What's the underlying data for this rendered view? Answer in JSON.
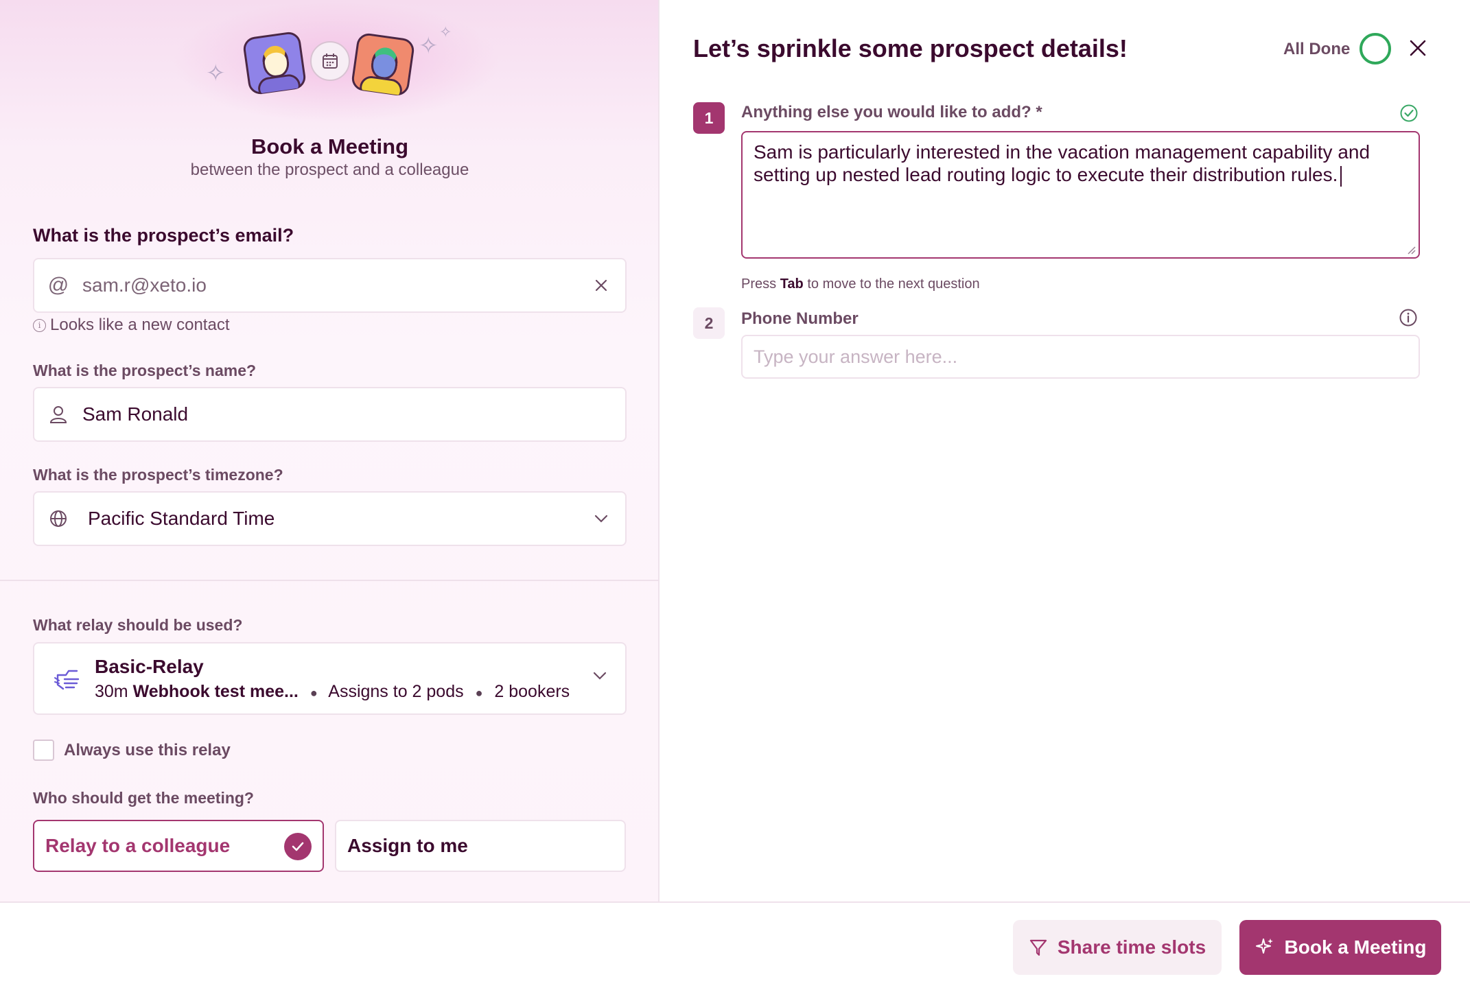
{
  "left": {
    "title": "Book a Meeting",
    "subtitle": "between the prospect and a colleague",
    "email": {
      "label": "What is the prospect’s email?",
      "value": "sam.r@xeto.io",
      "hint": "Looks like a new contact"
    },
    "name": {
      "label": "What is the prospect’s name?",
      "value": "Sam Ronald"
    },
    "timezone": {
      "label": "What is the prospect’s timezone?",
      "value": "Pacific Standard Time"
    },
    "relay": {
      "label": "What relay should be used?",
      "name": "Basic-Relay",
      "duration": "30m",
      "meeting": "Webhook test mee...",
      "pods": "Assigns to 2 pods",
      "bookers": "2 bookers"
    },
    "always_relay": {
      "label": "Always use this relay",
      "checked": false
    },
    "recipient": {
      "label": "Who should get the meeting?",
      "options": [
        "Relay to a colleague",
        "Assign to me"
      ],
      "selected": "Relay to a colleague"
    }
  },
  "right": {
    "title": "Let’s sprinkle some prospect details!",
    "all_done": "All Done",
    "q1": {
      "number": "1",
      "label": "Anything else you would like to add? *",
      "value": "Sam is particularly interested in the vacation management capability and setting up nested lead routing logic to execute their distribution rules."
    },
    "press_tab": {
      "prefix": "Press",
      "key": "Tab",
      "suffix": "to move to the next question"
    },
    "q2": {
      "number": "2",
      "label": "Phone Number",
      "placeholder": "Type your answer here..."
    }
  },
  "footer": {
    "share_label": "Share time slots",
    "book_label": "Book a Meeting"
  },
  "colors": {
    "accent": "#a3366f",
    "done": "#2fa85a",
    "text": "#3b0a2e"
  }
}
